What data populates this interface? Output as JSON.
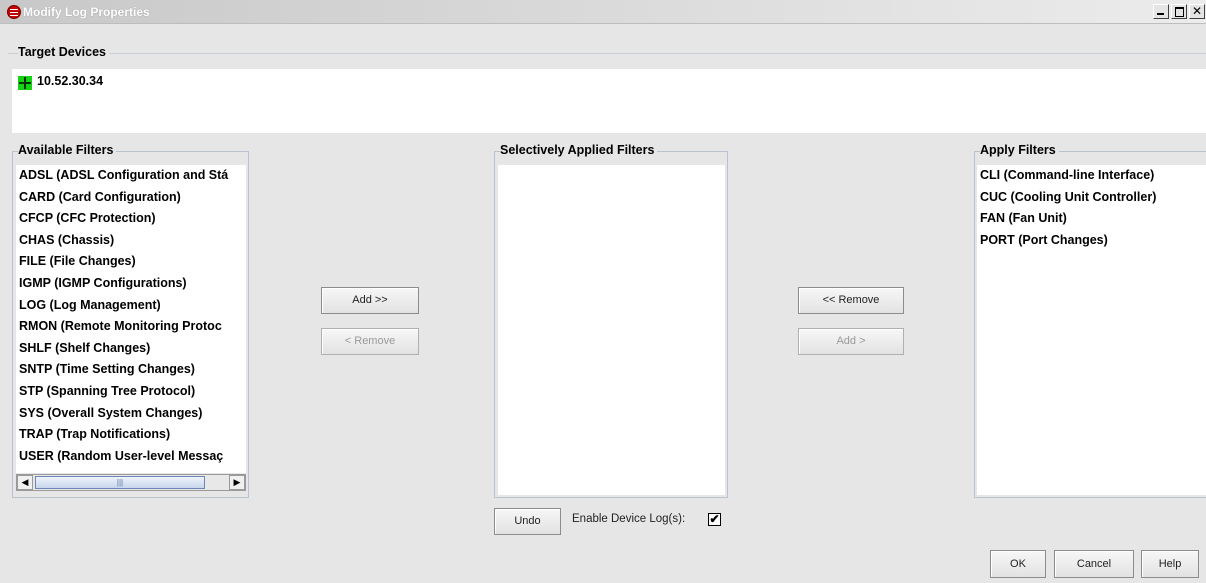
{
  "window": {
    "title": "Modify Log Properties"
  },
  "target_devices": {
    "title": "Target Devices",
    "device": "10.52.30.34"
  },
  "available_filters": {
    "title": "Available Filters",
    "items": [
      "ADSL (ADSL Configuration and Stá",
      "CARD (Card Configuration)",
      "CFCP (CFC Protection)",
      "CHAS (Chassis)",
      "FILE (File Changes)",
      "IGMP (IGMP Configurations)",
      "LOG (Log Management)",
      "RMON (Remote Monitoring Protoc",
      "SHLF (Shelf Changes)",
      "SNTP (Time Setting Changes)",
      "STP (Spanning Tree Protocol)",
      "SYS (Overall System Changes)",
      "TRAP (Trap Notifications)",
      "USER (Random User-level Messaç"
    ]
  },
  "selective_filters": {
    "title": "Selectively Applied Filters",
    "items": []
  },
  "apply_filters": {
    "title": "Apply Filters",
    "items": [
      "CLI (Command-line Interface)",
      "CUC (Cooling Unit Controller)",
      "FAN (Fan Unit)",
      "PORT (Port Changes)"
    ]
  },
  "buttons": {
    "add_left": "Add >>",
    "remove_left": "< Remove",
    "remove_right": "<< Remove",
    "add_right": "Add >",
    "undo": "Undo",
    "ok": "OK",
    "cancel": "Cancel",
    "help": "Help"
  },
  "enable_device_log": {
    "label": "Enable Device Log(s):",
    "checked": true,
    "check_glyph": "✔"
  },
  "scrollbar": {
    "left_arrow": "◀",
    "right_arrow": "▶",
    "thumb_grip": "|||"
  }
}
